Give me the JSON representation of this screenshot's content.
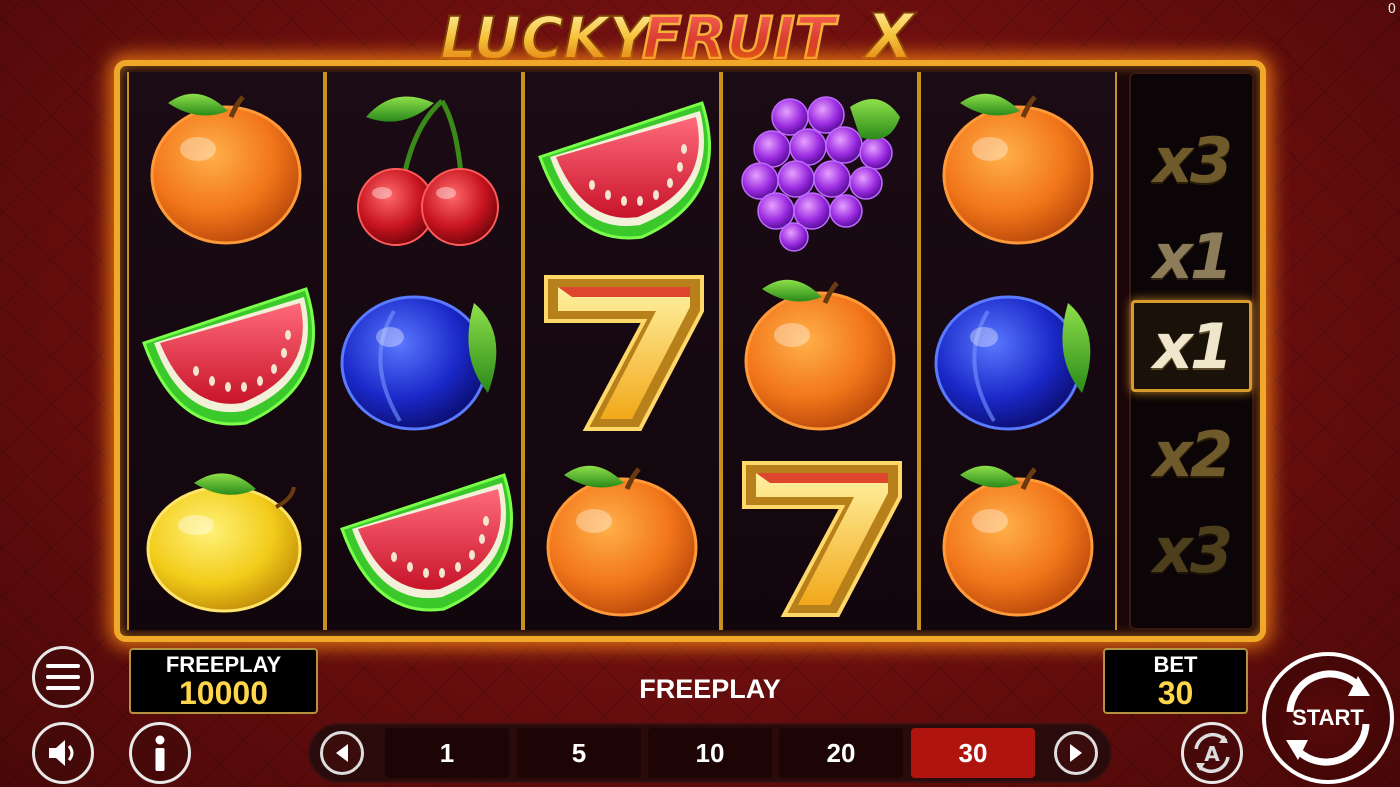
{
  "corner_counter": "0",
  "title": {
    "word1": "LUCKY",
    "word2": "FRUIT",
    "word3": "X"
  },
  "reels": [
    [
      "orange",
      "watermelon",
      "lemon"
    ],
    [
      "cherry",
      "plum",
      "watermelon"
    ],
    [
      "watermelon",
      "seven",
      "orange"
    ],
    [
      "grapes",
      "orange",
      "seven"
    ],
    [
      "orange",
      "plum",
      "orange"
    ]
  ],
  "multipliers": [
    "x3",
    "x1",
    "x1",
    "x2",
    "x3"
  ],
  "active_multiplier_index": 2,
  "balance": {
    "label": "FREEPLAY",
    "value": "10000"
  },
  "status": "FREEPLAY",
  "bet": {
    "label": "BET",
    "value": "30"
  },
  "bet_options": [
    "1",
    "5",
    "10",
    "20",
    "30"
  ],
  "selected_bet_index": 4,
  "start_label": "START",
  "icons": {
    "menu": "hamburger-menu-icon",
    "sound": "speaker-icon",
    "info": "info-icon",
    "prev": "arrow-left-icon",
    "next": "arrow-right-icon",
    "autoplay": "autoplay-icon",
    "start": "spin-arrows-icon"
  },
  "colors": {
    "accent": "#f0a82a",
    "bet_selected": "#b0140e",
    "value_yellow": "#ffd54a"
  }
}
